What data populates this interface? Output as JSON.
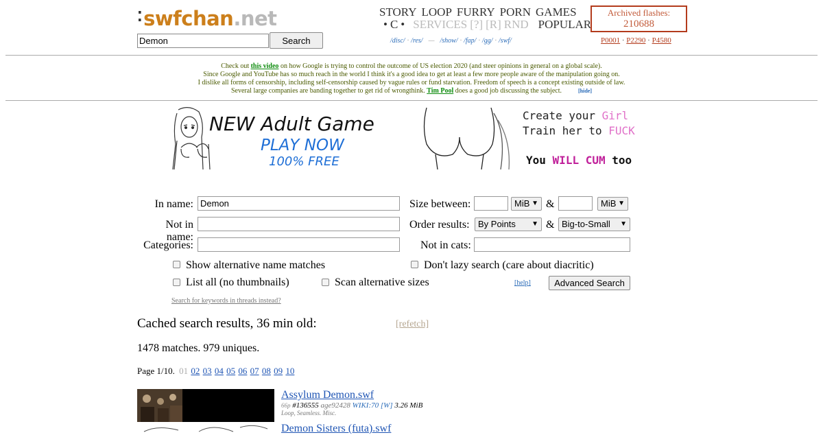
{
  "header": {
    "logo_swf": "swfchan",
    "logo_net": ".net",
    "search_value": "Demon",
    "search_button": "Search",
    "nav_row1": [
      "STORY",
      "LOOP",
      "FURRY",
      "PORN",
      "GAMES"
    ],
    "nav_row2_bullet1": "•",
    "nav_row2_c": "C",
    "nav_row2_bullet2": "•",
    "nav_row2_dim": [
      "SERVICES",
      "[?]",
      "[R]",
      "RND"
    ],
    "nav_row2_popular": "POPULAR",
    "boards": [
      "/disc/",
      "/res/",
      "—",
      "/show/",
      "/fap/",
      "/gg/",
      "/swf/"
    ],
    "archived_label": "Archived flashes:",
    "archived_count": "210688",
    "page_links": [
      "P0001",
      "P2290",
      "P4580"
    ]
  },
  "notice": {
    "line1_pre": "Check out ",
    "line1_link": "this video",
    "line1_post": " on how Google is trying to control the outcome of US election 2020 (and steer opinions in general on a global scale).",
    "line2": "Since Google and YouTube has so much reach in the world I think it's a good idea to get at least a few more people aware of the manipulation going on.",
    "line3": "I dislike all forms of censorship, including self-censorship caused by vague rules or fund starvation. Freedom of speech is a concept existing outside of law.",
    "line4_pre": "Several large companies are banding together to get rid of wrongthink. ",
    "line4_link": "Tim Pool",
    "line4_post": " does a good job discussing the subject.",
    "hide": "[hide]"
  },
  "banner": {
    "headline": "NEW Adult Game",
    "play": "PLAY NOW",
    "free": "100% FREE",
    "create_pre": "Create your ",
    "create_word": "Girl",
    "train_pre": "Train her to ",
    "train_word": "FUCK",
    "you": "You",
    "will": "WILL",
    "cum": "CUM",
    "too": "too",
    "color_pink": "#e070c8",
    "color_magenta": "#c0209a",
    "color_blue": "#1f6fd6"
  },
  "form": {
    "in_name_label": "In name:",
    "in_name_value": "Demon",
    "not_in_name_label": "Not in name:",
    "categories_label": "Categories:",
    "size_label": "Size between:",
    "size_unit1": "MiB",
    "size_and": "&",
    "size_unit2": "MiB",
    "order_label": "Order results:",
    "order_by": "By Points",
    "order_and": "&",
    "order_dir": "Big-to-Small",
    "not_in_cats_label": "Not in cats:",
    "opt_alt_names": "Show alternative name matches",
    "opt_no_lazy": "Don't lazy search (care about diacritic)",
    "opt_list_all": "List all (no thumbnails)",
    "opt_scan_sizes": "Scan alternative sizes",
    "help": "[help]",
    "advanced_button": "Advanced Search",
    "keyword_link": "Search for keywords in threads instead?"
  },
  "results": {
    "cached": "Cached search results, 36 min old:",
    "refetch": "[refetch]",
    "matches": "1478 matches. 979 uniques.",
    "page_label": "Page 1/10.",
    "current_page": "01",
    "pages": [
      "02",
      "03",
      "04",
      "05",
      "06",
      "07",
      "08",
      "09",
      "10"
    ],
    "items": [
      {
        "title": "Assylum Demon.swf",
        "points": "66p",
        "id": "#136555",
        "age": "age92428",
        "wiki": "WIKI:70",
        "w": "[W]",
        "size": "3.26 MiB",
        "tags": "Loop, Seamless. Misc."
      },
      {
        "title": "Demon Sisters (futa).swf"
      }
    ]
  }
}
